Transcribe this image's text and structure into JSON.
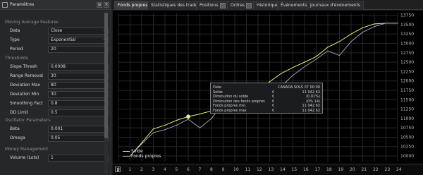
{
  "panel": {
    "title": "Paramètres",
    "sections": [
      {
        "title": "Moving Average Features",
        "rows": [
          {
            "label": "Data",
            "value": "Close",
            "control": "select"
          },
          {
            "label": "Type",
            "value": "Exponential",
            "control": "select"
          },
          {
            "label": "Period",
            "value": "20",
            "control": "spin"
          }
        ]
      },
      {
        "title": "Thresholds",
        "rows": [
          {
            "label": "Slope Thresh",
            "value": "0.0008",
            "control": "spin"
          },
          {
            "label": "Range Removal",
            "value": "30",
            "control": "spin"
          },
          {
            "label": "Deviation Max",
            "value": "80",
            "control": "spin"
          },
          {
            "label": "Deviation Min",
            "value": "30",
            "control": "spin"
          },
          {
            "label": "Smoothing Fact",
            "value": "0.8",
            "control": "spin"
          },
          {
            "label": "DD Limit",
            "value": "0.5",
            "control": "spin"
          }
        ]
      },
      {
        "title": "Oscillator Parameters",
        "rows": [
          {
            "label": "Beta",
            "value": "0.001",
            "control": "spin"
          },
          {
            "label": "Omega",
            "value": "0.05",
            "control": "spin"
          }
        ]
      },
      {
        "title": "Money Management",
        "rows": [
          {
            "label": "Volume (Lots)",
            "value": "1",
            "control": "spin"
          }
        ]
      }
    ]
  },
  "tabs": [
    {
      "label": "Fonds propres",
      "active": true
    },
    {
      "label": "Statistiques des trades",
      "active": false
    },
    {
      "label": "Positions",
      "active": false,
      "badge": true
    },
    {
      "label": "Ordres",
      "active": false,
      "badge": true
    },
    {
      "label": "Historique",
      "active": false
    },
    {
      "label": "Événements",
      "active": false
    },
    {
      "label": "Journaux d'événements",
      "active": false
    }
  ],
  "chart_data": {
    "type": "line",
    "x": [
      1,
      2,
      3,
      4,
      5,
      6,
      7,
      8,
      9,
      10,
      11,
      12,
      13,
      14,
      15,
      16,
      17,
      18,
      19,
      20,
      21,
      22,
      23,
      24
    ],
    "series": [
      {
        "name": "Solde",
        "color": "#e8f070",
        "values": [
          10000,
          10350,
          10720,
          10820,
          10950,
          11050,
          11120,
          11200,
          11540,
          11700,
          11860,
          11700,
          11980,
          12200,
          12360,
          12500,
          12650,
          12900,
          13050,
          13250,
          13420,
          13520,
          13540,
          13540
        ]
      },
      {
        "name": "Fonds propres",
        "color": "#9aa4b8",
        "values": [
          10000,
          10320,
          10620,
          10700,
          10820,
          10980,
          10750,
          11000,
          11420,
          11620,
          11760,
          11550,
          11780,
          11860,
          12150,
          12380,
          12580,
          12800,
          12680,
          13050,
          13300,
          13450,
          13540,
          13540
        ]
      }
    ],
    "ylim": [
      9850,
      13800
    ],
    "yticks": [
      10000,
      10250,
      10500,
      10750,
      11000,
      11250,
      11500,
      11750,
      12000,
      12250,
      12500,
      12750,
      13000,
      13250,
      13500,
      13750
    ],
    "xtick_labels": [
      "0",
      "1",
      "2",
      "3",
      "4",
      "5",
      "6",
      "7",
      "8",
      "9",
      "10",
      "11",
      "12",
      "13",
      "14",
      "15",
      "16",
      "17",
      "18",
      "19",
      "20",
      "21",
      "22",
      "23",
      "24"
    ],
    "grid": true,
    "legend": "bottom-left",
    "tooltip": {
      "rows": [
        {
          "label": "Date",
          "unit": "",
          "value": "CANADA SOLS 07 00:00"
        },
        {
          "label": "Solde",
          "unit": "€",
          "value": "11 042.62"
        },
        {
          "label": "Diminution du solde",
          "unit": "€",
          "value": "(0.01%)"
        },
        {
          "label": "Diminution des fonds propres",
          "unit": "€",
          "value": "(0% 14)"
        },
        {
          "label": "Fonds propres min.",
          "unit": "€",
          "value": "11 042.62"
        },
        {
          "label": "Fonds propres max",
          "unit": "€",
          "value": "11 042.62"
        }
      ]
    }
  }
}
